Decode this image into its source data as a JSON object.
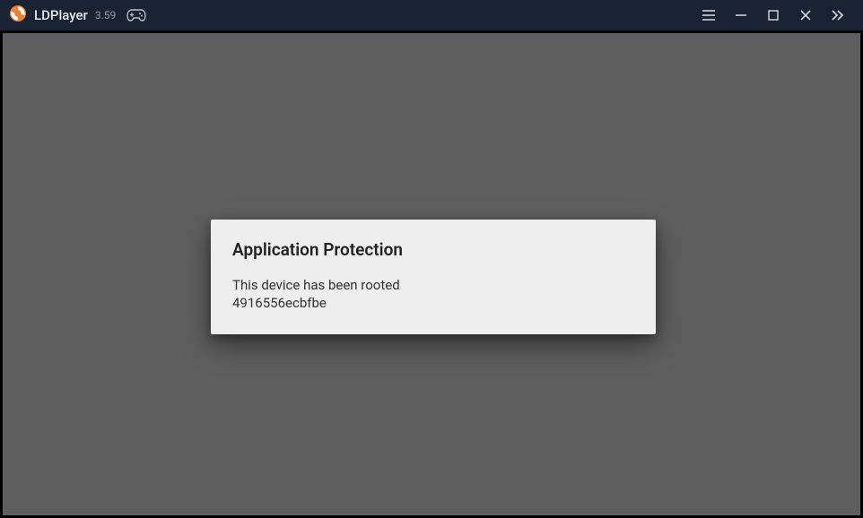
{
  "titlebar": {
    "app_name": "LDPlayer",
    "app_version": "3.59"
  },
  "dialog": {
    "title": "Application Protection",
    "message_line1": "This device has been rooted",
    "message_line2": "4916556ecbfbe"
  }
}
